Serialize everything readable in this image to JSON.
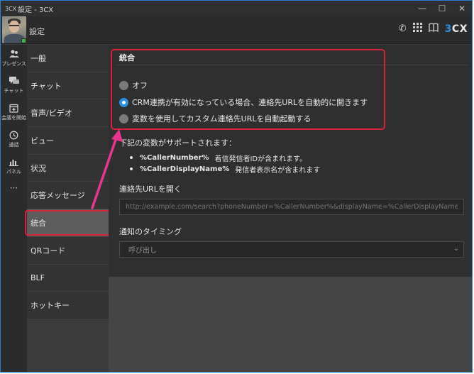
{
  "window": {
    "app_logo": "3CX",
    "title": "設定 - 3CX"
  },
  "header": {
    "title": "設定",
    "brand_prefix": "3",
    "brand_suffix": "CX"
  },
  "rail": {
    "items": [
      {
        "label": "プレゼンス",
        "icon": "people-icon"
      },
      {
        "label": "チャット",
        "icon": "chat-icon"
      },
      {
        "label": "会議を開始",
        "icon": "meeting-icon"
      },
      {
        "label": "通話",
        "icon": "history-icon"
      },
      {
        "label": "パネル",
        "icon": "panel-icon"
      }
    ],
    "more": "···"
  },
  "nav": {
    "items": [
      {
        "label": "一般"
      },
      {
        "label": "チャット"
      },
      {
        "label": "音声/ビデオ"
      },
      {
        "label": "ビュー"
      },
      {
        "label": "状況"
      },
      {
        "label": "応答メッセージ"
      },
      {
        "label": "統合",
        "active": true
      },
      {
        "label": "QRコード"
      },
      {
        "label": "BLF"
      },
      {
        "label": "ホットキー"
      }
    ]
  },
  "content": {
    "section_title": "統合",
    "options": [
      {
        "label": "オフ",
        "checked": false
      },
      {
        "label": "CRM連携が有効になっている場合、連絡先URLを自動的に開きます",
        "checked": true
      },
      {
        "label": "変数を使用してカスタム連絡先URLを自動起動する",
        "checked": false
      }
    ],
    "vars_title": "下記の変数がサポートされます：",
    "vars": [
      {
        "name": "%CallerNumber%",
        "desc": "着信発信者IDが含まれます。"
      },
      {
        "name": "%CallerDisplayName%",
        "desc": "発信者表示名が含まれます"
      }
    ],
    "url_label": "連絡先URLを開く",
    "url_placeholder": "http://example.com/search?phoneNumber=%CallerNumber%&displayName=%CallerDisplayName%",
    "timing_label": "通知のタイミング",
    "timing_value": "呼び出し"
  },
  "colors": {
    "accent": "#2c8fe0",
    "highlight": "#d8223a",
    "presence": "#3bb54a"
  }
}
